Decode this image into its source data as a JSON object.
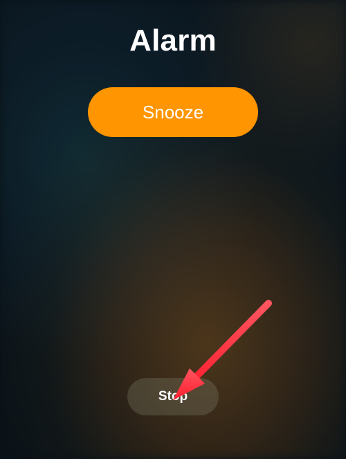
{
  "title": "Alarm",
  "snooze_label": "Snooze",
  "stop_label": "Stop",
  "colors": {
    "accent": "#ff9500",
    "annotation": "#ff2b3a"
  }
}
